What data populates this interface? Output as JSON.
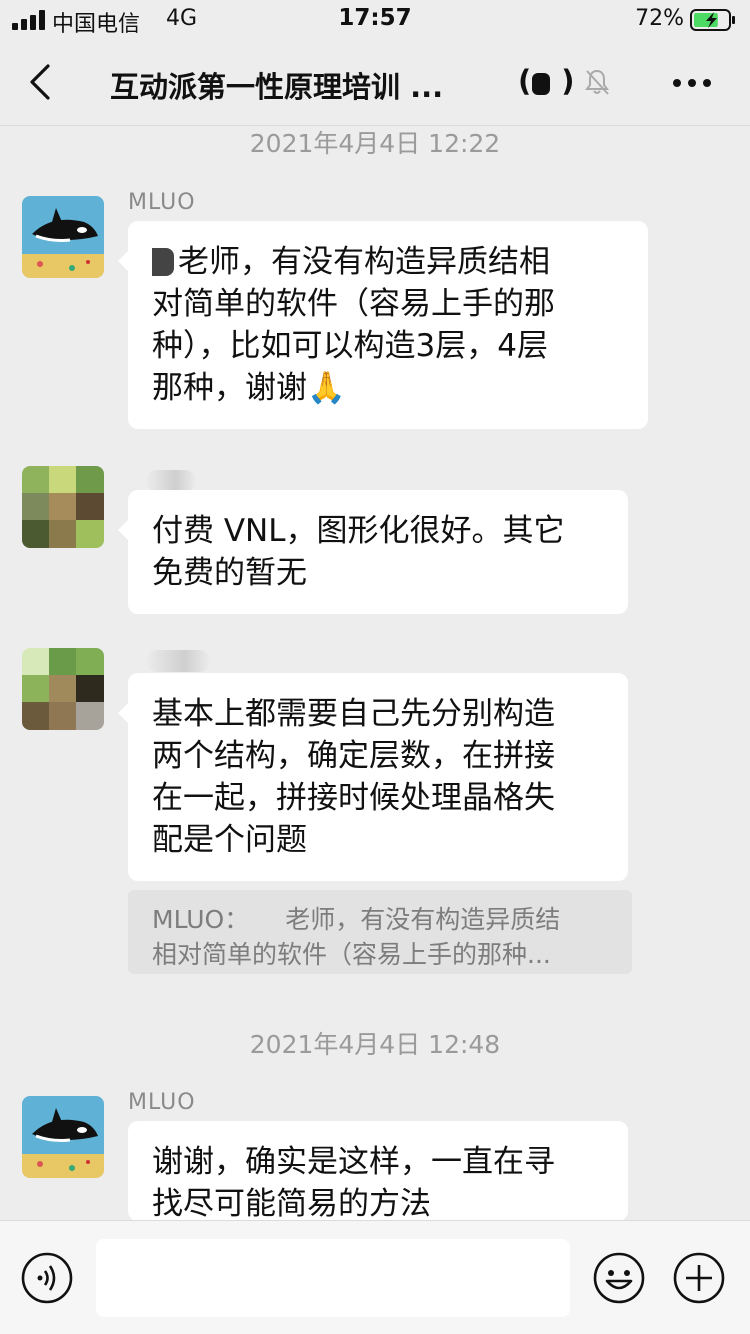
{
  "status": {
    "carrier": "中国电信",
    "network": "4G",
    "time": "17:57",
    "battery": "72%",
    "battery_level": 0.72
  },
  "nav": {
    "title": "互动派第一性原理培训 ...",
    "member_open": "(",
    "member_close": ")"
  },
  "messages": [
    {
      "timestamp": "2021年4月4日 12:22",
      "sender": "MLUO",
      "lines": [
        "老师，有没有构造异质结相",
        "对简单的软件（容易上手的那",
        "种），比如可以构造3层，4层",
        "那种，谢谢🙏"
      ]
    },
    {
      "lines": [
        "付费 VNL，图形化很好。其它",
        "免费的暂无"
      ]
    },
    {
      "lines": [
        "基本上都需要自己先分别构造",
        "两个结构，确定层数，在拼接",
        "在一起，拼接时候处理晶格失",
        "配是个问题"
      ],
      "quote": {
        "prefix": "MLUO：",
        "line1": "老师，有没有构造异质结",
        "line2": "相对简单的软件（容易上手的那种..."
      }
    },
    {
      "timestamp": "2021年4月4日 12:48",
      "sender": "MLUO",
      "lines": [
        "谢谢，确实是这样，一直在寻",
        "找尽可能简易的方法"
      ]
    }
  ],
  "input": {
    "placeholder": ""
  },
  "icons": {
    "back": "chevron-left-icon",
    "mute": "bell-slash-icon",
    "more": "more-dots-icon",
    "voice": "voice-icon",
    "emoji": "emoji-icon",
    "plus": "plus-icon"
  },
  "colors": {
    "background": "#ededed",
    "bubble": "#ffffff",
    "quote": "#e2e2e2",
    "timestamp": "#9a9a9a",
    "battery": "#4cd964"
  }
}
